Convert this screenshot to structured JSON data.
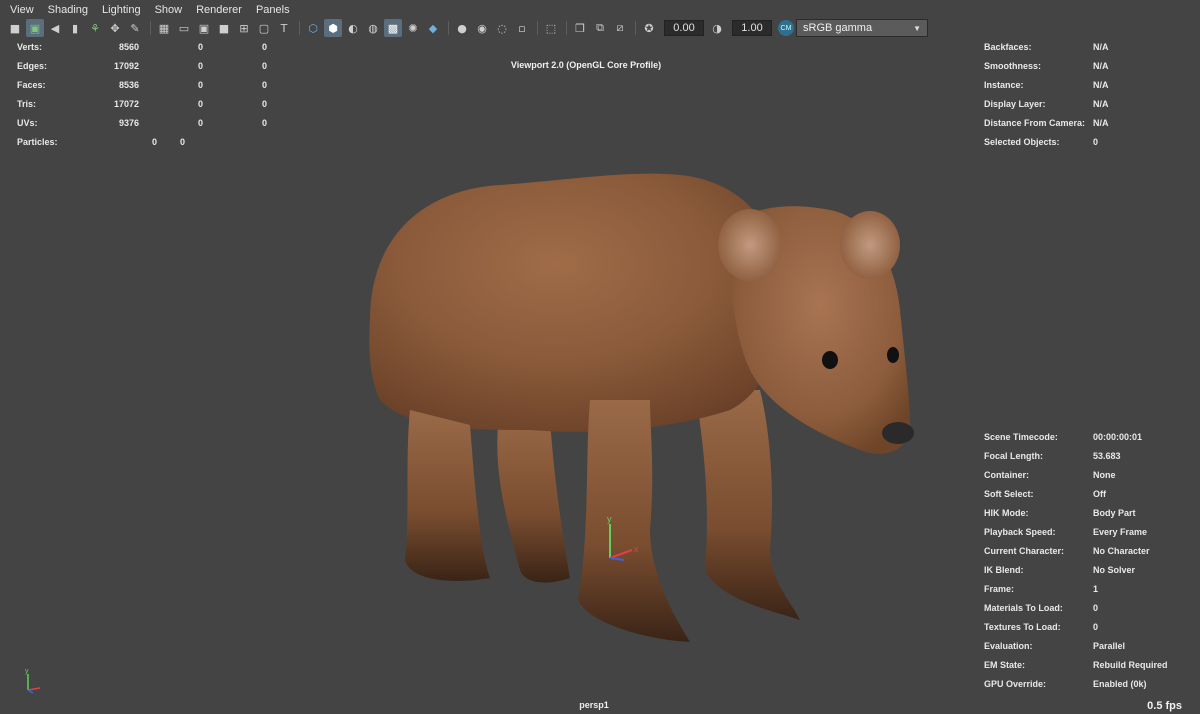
{
  "menu": [
    "View",
    "Shading",
    "Lighting",
    "Show",
    "Renderer",
    "Panels"
  ],
  "toolbar": {
    "exposure": "0.00",
    "gamma": "1.00",
    "color_space": "sRGB gamma"
  },
  "viewport": {
    "title": "Viewport 2.0 (OpenGL Core Profile)",
    "camera": "persp1",
    "fps": "0.5 fps"
  },
  "hud_left": [
    {
      "label": "Verts:",
      "v1": "8560",
      "v2": "0",
      "v3": "0"
    },
    {
      "label": "Edges:",
      "v1": "17092",
      "v2": "0",
      "v3": "0"
    },
    {
      "label": "Faces:",
      "v1": "8536",
      "v2": "0",
      "v3": "0"
    },
    {
      "label": "Tris:",
      "v1": "17072",
      "v2": "0",
      "v3": "0"
    },
    {
      "label": "UVs:",
      "v1": "9376",
      "v2": "0",
      "v3": "0"
    }
  ],
  "hud_particles": {
    "label": "Particles:",
    "v1": "0",
    "v2": "0"
  },
  "hud_right_top": [
    {
      "label": "Backfaces:",
      "value": "N/A"
    },
    {
      "label": "Smoothness:",
      "value": "N/A"
    },
    {
      "label": "Instance:",
      "value": "N/A"
    },
    {
      "label": "Display Layer:",
      "value": "N/A"
    },
    {
      "label": "Distance From Camera:",
      "value": "N/A"
    },
    {
      "label": "Selected Objects:",
      "value": "0"
    }
  ],
  "hud_right_bottom": [
    {
      "label": "Scene Timecode:",
      "value": "00:00:00:01"
    },
    {
      "label": "Focal Length:",
      "value": "53.683"
    },
    {
      "label": "Container:",
      "value": "None"
    },
    {
      "label": "Soft Select:",
      "value": "Off"
    },
    {
      "label": "HIK Mode:",
      "value": "Body Part"
    },
    {
      "label": "Playback Speed:",
      "value": "Every Frame"
    },
    {
      "label": "Current Character:",
      "value": "No Character"
    },
    {
      "label": "IK Blend:",
      "value": "No Solver"
    },
    {
      "label": "Frame:",
      "value": "1"
    },
    {
      "label": "Materials To Load:",
      "value": "0"
    },
    {
      "label": "Textures To Load:",
      "value": "0"
    },
    {
      "label": "Evaluation:",
      "value": "Parallel"
    },
    {
      "label": "EM State:",
      "value": "Rebuild Required"
    },
    {
      "label": "GPU Override:",
      "value": "Enabled (0k)"
    }
  ],
  "axis": {
    "y": "y",
    "x": "x"
  },
  "colors": {
    "background": "#444444",
    "bear_fur": "#8a5a3a",
    "axis_x": "#e04040",
    "axis_y": "#60d060",
    "axis_z": "#4060e0"
  }
}
